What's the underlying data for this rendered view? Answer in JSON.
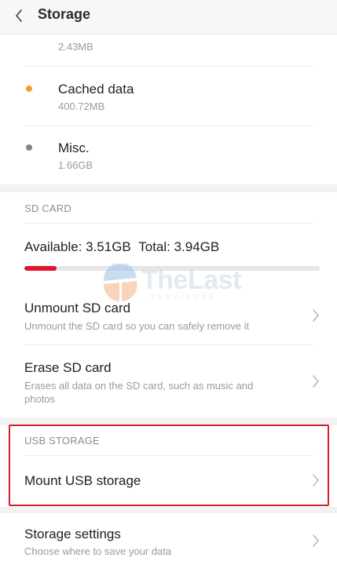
{
  "header": {
    "title": "Storage"
  },
  "storage_items": [
    {
      "label": "",
      "value": "2.43MB"
    },
    {
      "label": "Cached data",
      "value": "400.72MB",
      "dot_color": "#f39c2e"
    },
    {
      "label": "Misc.",
      "value": "1.66GB",
      "dot_color": "#7c8894"
    }
  ],
  "sd_card": {
    "section_title": "SD CARD",
    "available": "Available: 3.51GB",
    "total": "Total: 3.94GB",
    "used_fraction": 0.11,
    "unmount": {
      "title": "Unmount SD card",
      "subtitle": "Unmount the SD card so you can safely remove it"
    },
    "erase": {
      "title": "Erase SD card",
      "subtitle": "Erases all data on the SD card, such as music and photos"
    }
  },
  "usb_storage": {
    "section_title": "USB STORAGE",
    "mount": {
      "title": "Mount USB storage"
    }
  },
  "storage_settings": {
    "title": "Storage settings",
    "subtitle": "Choose where to save your data"
  },
  "watermark": {
    "text": "TheLast",
    "sub": "SURVIVORS"
  },
  "colors": {
    "accent": "#e3142a",
    "highlight_border": "#d61f26"
  }
}
